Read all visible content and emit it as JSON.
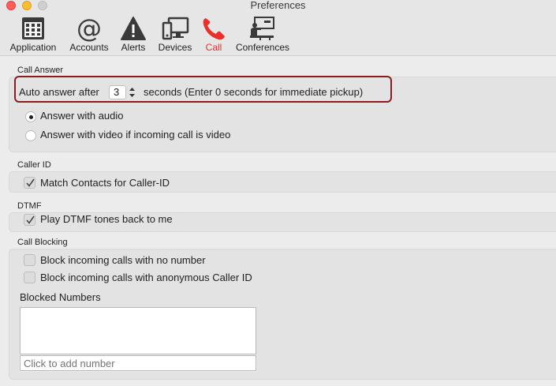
{
  "window": {
    "title": "Preferences"
  },
  "toolbar": {
    "items": [
      {
        "label": "Application",
        "icon": "application-grid-icon",
        "active": false
      },
      {
        "label": "Accounts",
        "icon": "at-sign-icon",
        "active": false
      },
      {
        "label": "Alerts",
        "icon": "warning-triangle-icon",
        "active": false
      },
      {
        "label": "Devices",
        "icon": "devices-monitor-icon",
        "active": false
      },
      {
        "label": "Call",
        "icon": "phone-handset-icon",
        "active": true
      },
      {
        "label": "Conferences",
        "icon": "conference-presentation-icon",
        "active": false
      }
    ],
    "active_color": "#e8312a"
  },
  "call_answer": {
    "title": "Call Answer",
    "auto_answer_label": "Auto answer after",
    "auto_answer_value": "3",
    "auto_answer_suffix": "seconds (Enter 0 seconds for immediate pickup)",
    "options": [
      {
        "label": "Answer with audio",
        "selected": true
      },
      {
        "label": "Answer with video if incoming call is video",
        "selected": false
      }
    ],
    "highlight_color": "#8b1a24"
  },
  "caller_id": {
    "title": "Caller ID",
    "match_contacts": {
      "label": "Match Contacts for Caller-ID",
      "checked": true
    }
  },
  "dtmf": {
    "title": "DTMF",
    "play_tones": {
      "label": "Play DTMF tones back to me",
      "checked": true
    }
  },
  "call_blocking": {
    "title": "Call Blocking",
    "block_no_number": {
      "label": "Block incoming calls with no number",
      "checked": false
    },
    "block_anonymous": {
      "label": "Block incoming calls with anonymous Caller ID",
      "checked": false
    },
    "blocked_numbers_label": "Blocked Numbers",
    "add_placeholder": "Click to add number"
  }
}
